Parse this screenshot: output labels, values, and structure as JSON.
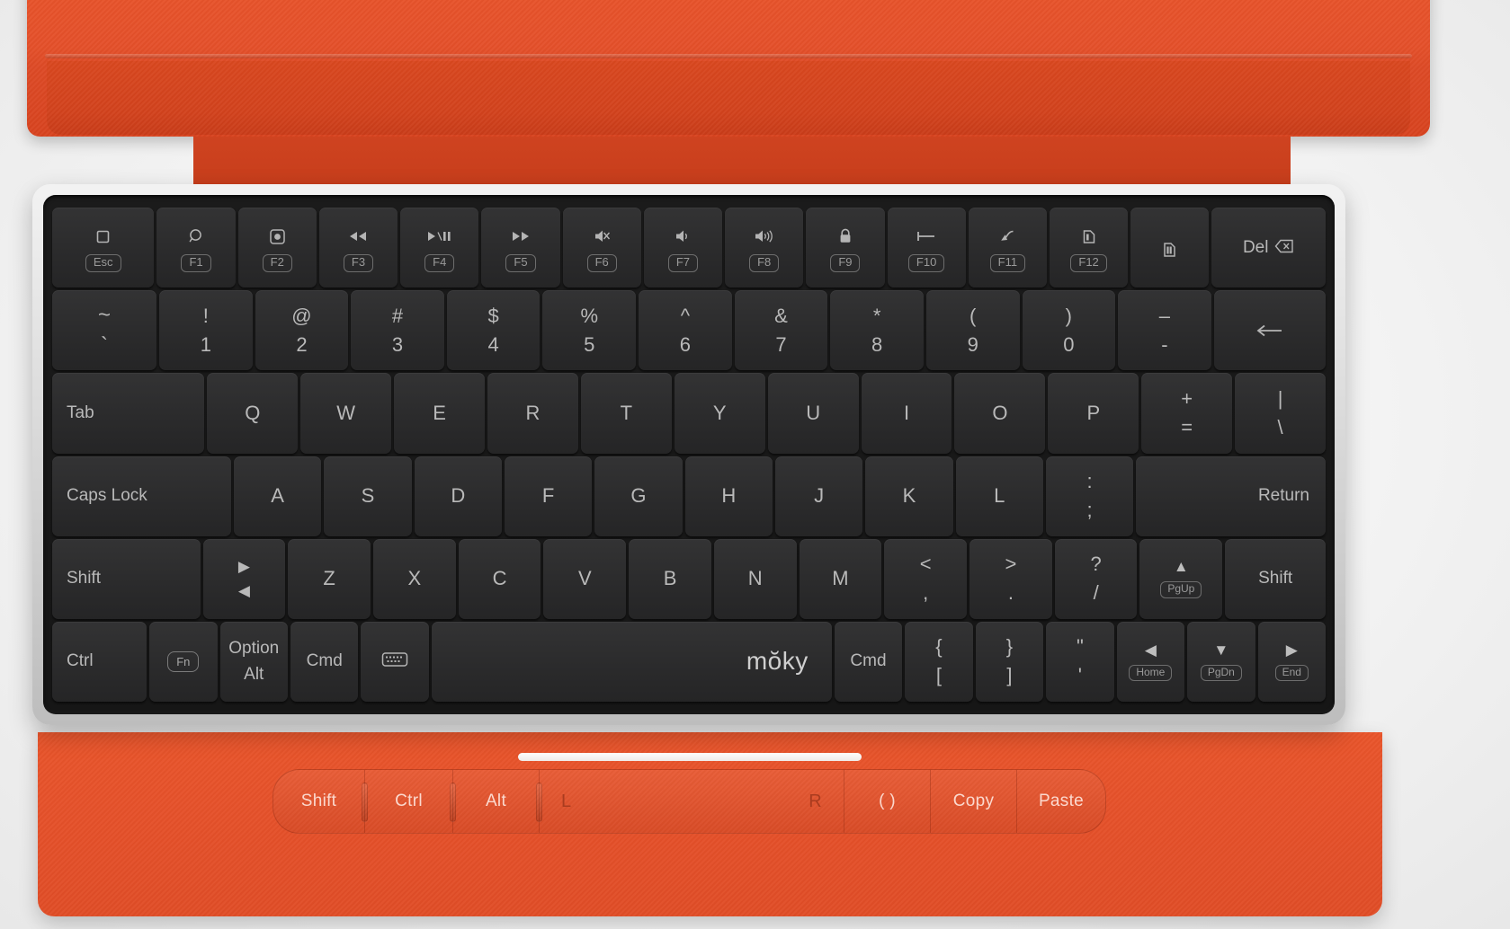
{
  "device": {
    "brand": "mŏky",
    "lid_color": "#e4502a",
    "base_color": "#e5512a",
    "key_color": "#2b2b2c",
    "frame_color": "#d9d9d9"
  },
  "keyboard": {
    "function_row": [
      {
        "name": "esc",
        "glyph": "▢",
        "label": "Esc",
        "icon": "stop-square-icon"
      },
      {
        "name": "f1",
        "glyph": "◯",
        "label": "F1",
        "icon": "search-icon"
      },
      {
        "name": "f2",
        "glyph": "⊡",
        "label": "F2",
        "icon": "screenshot-icon"
      },
      {
        "name": "f3",
        "glyph": "◀◀",
        "label": "F3",
        "icon": "rewind-icon"
      },
      {
        "name": "f4",
        "glyph": "▶/❙❙",
        "label": "F4",
        "icon": "play-pause-icon"
      },
      {
        "name": "f5",
        "glyph": "▶▶",
        "label": "F5",
        "icon": "fast-forward-icon"
      },
      {
        "name": "f6",
        "glyph": "✖",
        "label": "F6",
        "icon": "mute-icon"
      },
      {
        "name": "f7",
        "glyph": "◀)",
        "label": "F7",
        "icon": "volume-down-icon"
      },
      {
        "name": "f8",
        "glyph": "◀)))",
        "label": "F8",
        "icon": "volume-up-icon"
      },
      {
        "name": "f9",
        "glyph": "🔒",
        "label": "F9",
        "icon": "lock-icon"
      },
      {
        "name": "f10",
        "glyph": "⊢",
        "label": "F10",
        "icon": "home-bar-icon"
      },
      {
        "name": "f11",
        "glyph": "↙",
        "label": "F11",
        "icon": "minimize-icon"
      },
      {
        "name": "f12",
        "glyph": "▣",
        "label": "F12",
        "icon": "device-switch-icon"
      },
      {
        "name": "page",
        "glyph": "▤",
        "label": "",
        "icon": "pages-icon"
      },
      {
        "name": "del",
        "glyph": "⌫",
        "label": "Del",
        "icon": "delete-icon"
      }
    ],
    "number_row": [
      {
        "top": "~",
        "bot": "`"
      },
      {
        "top": "!",
        "bot": "1"
      },
      {
        "top": "@",
        "bot": "2"
      },
      {
        "top": "#",
        "bot": "3"
      },
      {
        "top": "$",
        "bot": "4"
      },
      {
        "top": "%",
        "bot": "5"
      },
      {
        "top": "^",
        "bot": "6"
      },
      {
        "top": "&",
        "bot": "7"
      },
      {
        "top": "*",
        "bot": "8"
      },
      {
        "top": "(",
        "bot": "9"
      },
      {
        "top": ")",
        "bot": "0"
      },
      {
        "top": "–",
        "bot": "-"
      },
      {
        "top": "",
        "bot": "←",
        "icon": "backspace-icon"
      }
    ],
    "tab_row": {
      "tab": "Tab",
      "letters": [
        "Q",
        "W",
        "E",
        "R",
        "T",
        "Y",
        "U",
        "I",
        "O",
        "P"
      ],
      "plus_equal": {
        "top": "+",
        "bot": "="
      },
      "pipe_slash": {
        "top": "|",
        "bot": "\\"
      }
    },
    "home_row": {
      "caps": "Caps Lock",
      "letters": [
        "A",
        "S",
        "D",
        "F",
        "G",
        "H",
        "J",
        "K",
        "L"
      ],
      "colon_semi": {
        "top": ":",
        "bot": ";"
      },
      "return": "Return"
    },
    "shift_row": {
      "shift_left": "Shift",
      "nav_key": {
        "top": "▶",
        "bot": "◀",
        "icon": "nav-arrows-icon"
      },
      "letters": [
        "Z",
        "X",
        "C",
        "V",
        "B",
        "N",
        "M"
      ],
      "lt_comma": {
        "top": "<",
        "bot": ","
      },
      "gt_period": {
        "top": ">",
        "bot": "."
      },
      "q_slash": {
        "top": "?",
        "bot": "/"
      },
      "up_pgup": {
        "glyph": "▲",
        "label": "PgUp"
      },
      "shift_right": "Shift"
    },
    "bottom_row": {
      "ctrl": "Ctrl",
      "fn": "Fn",
      "option_alt": {
        "top": "Option",
        "bot": "Alt"
      },
      "cmd_left": "Cmd",
      "kb_light": {
        "icon": "keyboard-backlight-icon"
      },
      "space_logo": "mŏky",
      "cmd_right": "Cmd",
      "brace_bracket": {
        "top": "{",
        "bot": "["
      },
      "brace_bracket_close": {
        "top": "}",
        "bot": "]"
      },
      "quote_apos": {
        "top": "\"",
        "bot": "'"
      },
      "left_home": {
        "glyph": "◀",
        "label": "Home"
      },
      "down_pgdn": {
        "glyph": "▼",
        "label": "PgDn"
      },
      "right_end": {
        "glyph": "▶",
        "label": "End"
      }
    }
  },
  "touch_strip": {
    "cells": [
      {
        "label": "Shift",
        "name": "strip-shift"
      },
      {
        "label": "Ctrl",
        "name": "strip-ctrl"
      },
      {
        "label": "Alt",
        "name": "strip-alt"
      },
      {
        "left": "L",
        "right": "R",
        "name": "strip-trackpad"
      },
      {
        "label": "( )",
        "name": "strip-parens"
      },
      {
        "label": "Copy",
        "name": "strip-copy"
      },
      {
        "label": "Paste",
        "name": "strip-paste"
      }
    ]
  }
}
